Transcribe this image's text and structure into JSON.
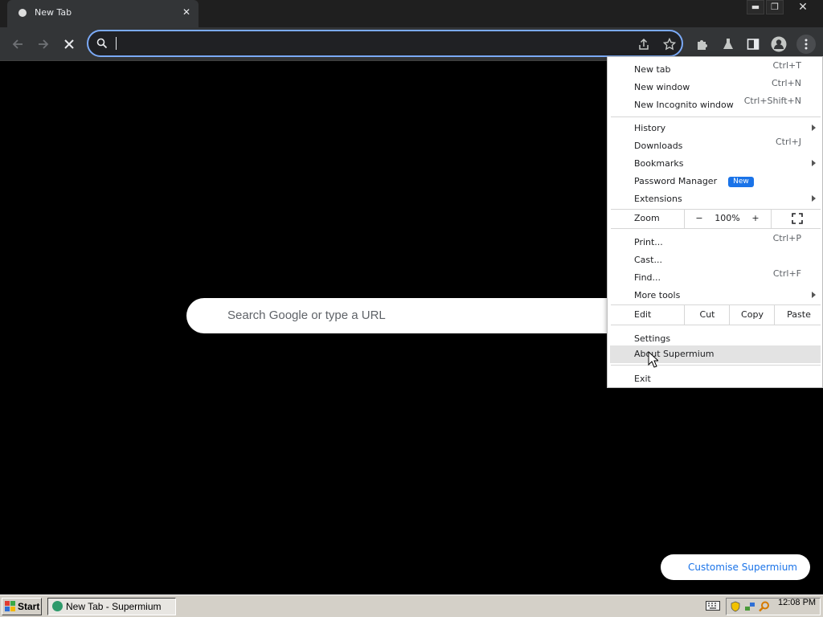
{
  "tab": {
    "title": "New Tab",
    "close_glyph": "✕"
  },
  "window_controls": {
    "minimize": "▬",
    "restore": "❐",
    "close": "✕"
  },
  "omnibox": {
    "value": "",
    "placeholder": ""
  },
  "ntp": {
    "search_placeholder": "Search Google or type a URL",
    "customise_label": "Customise Supermium"
  },
  "menu": {
    "new_tab": {
      "label": "New tab",
      "shortcut": "Ctrl+T"
    },
    "new_window": {
      "label": "New window",
      "shortcut": "Ctrl+N"
    },
    "new_incognito": {
      "label": "New Incognito window",
      "shortcut": "Ctrl+Shift+N"
    },
    "history": {
      "label": "History"
    },
    "downloads": {
      "label": "Downloads",
      "shortcut": "Ctrl+J"
    },
    "bookmarks": {
      "label": "Bookmarks"
    },
    "password_manager": {
      "label": "Password Manager",
      "badge": "New"
    },
    "extensions": {
      "label": "Extensions"
    },
    "zoom": {
      "label": "Zoom",
      "minus": "−",
      "value": "100%",
      "plus": "+"
    },
    "print": {
      "label": "Print...",
      "shortcut": "Ctrl+P"
    },
    "cast": {
      "label": "Cast..."
    },
    "find": {
      "label": "Find...",
      "shortcut": "Ctrl+F"
    },
    "more_tools": {
      "label": "More tools"
    },
    "edit": {
      "label": "Edit",
      "cut": "Cut",
      "copy": "Copy",
      "paste": "Paste"
    },
    "settings": {
      "label": "Settings"
    },
    "about": {
      "label": "About Supermium"
    },
    "exit": {
      "label": "Exit"
    }
  },
  "taskbar": {
    "start_label": "Start",
    "task_label": "New Tab - Supermium",
    "clock": "12:08 PM"
  },
  "colors": {
    "accent": "#1a73e8",
    "omnibox_focus": "#7baaf7",
    "toolbar": "#333537",
    "menu_highlight": "#e3e3e3"
  },
  "icons": [
    "back-arrow-icon",
    "forward-arrow-icon",
    "stop-icon",
    "search-icon",
    "share-icon",
    "star-icon",
    "extensions-puzzle-icon",
    "labs-flask-icon",
    "side-panel-icon",
    "profile-avatar-icon",
    "menu-kebab-icon",
    "fullscreen-icon",
    "keyboard-icon",
    "shield-icon",
    "network-icon",
    "search-tray-icon",
    "windows-logo-icon"
  ]
}
